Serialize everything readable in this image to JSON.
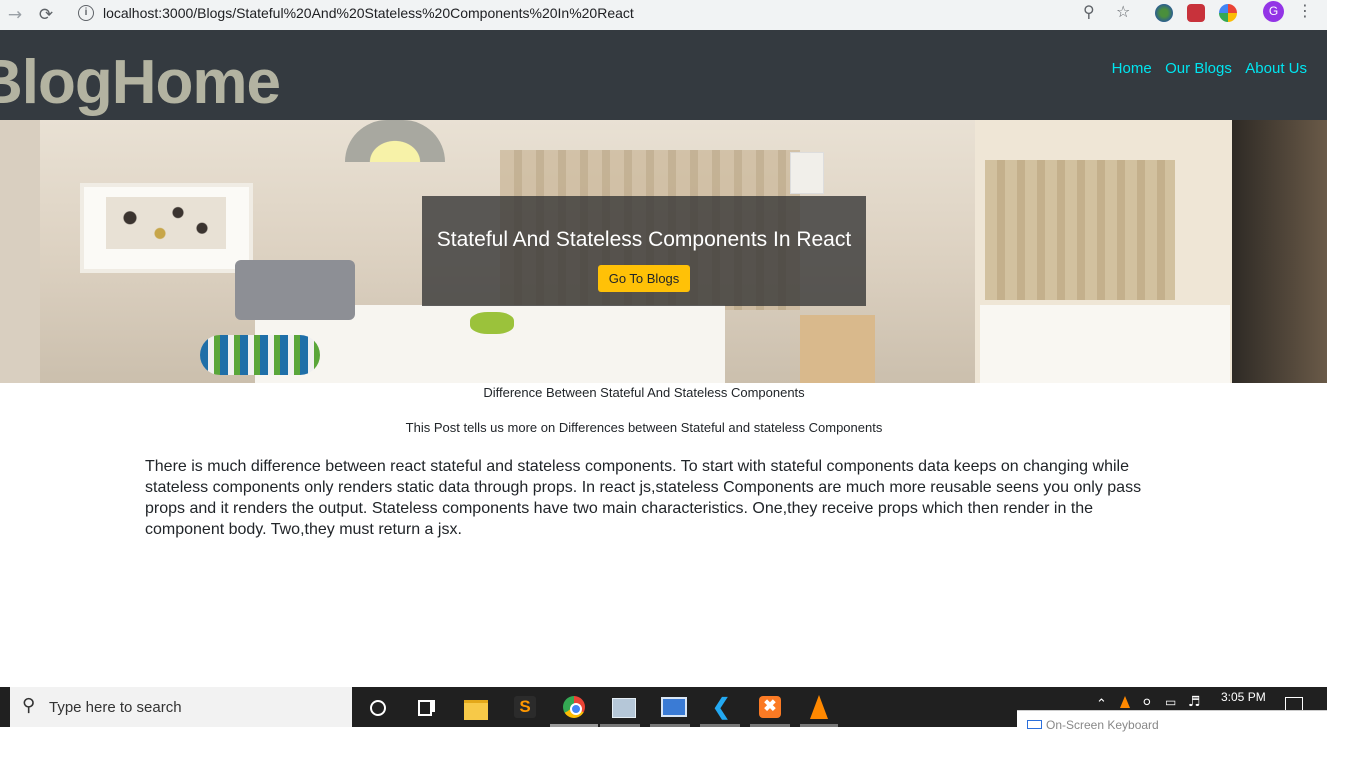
{
  "browser": {
    "url": "localhost:3000/Blogs/Stateful%20And%20Stateless%20Components%20In%20React",
    "profile_initial": "G",
    "back_icon": "back-arrow-icon",
    "reload_icon": "reload-icon"
  },
  "header": {
    "brand": "BlogHome",
    "nav": [
      {
        "label": "Home"
      },
      {
        "label": "Our Blogs"
      },
      {
        "label": "About Us"
      }
    ],
    "link_color": "#00e5f0",
    "bg_color": "#343a40"
  },
  "hero": {
    "title": "Stateful And Stateless Components In React",
    "button_label": "Go To Blogs",
    "button_color": "#ffc107"
  },
  "post": {
    "title": "Difference Between Stateful And Stateless Components",
    "subtitle": "This Post tells us more on Differences between Stateful and stateless Components",
    "body": "There is much difference between react stateful and stateless components. To start with stateful components data keeps on changing while stateless components only renders static data through props. In react js,stateless Components are much more reusable seens you only pass props and it renders the output. Stateless components have two main characteristics. One,they receive props which then render in the component body. Two,they must return a jsx."
  },
  "taskbar": {
    "search_placeholder": "Type here to search",
    "time": "3:05 PM",
    "osk_label": "On-Screen Keyboard"
  }
}
